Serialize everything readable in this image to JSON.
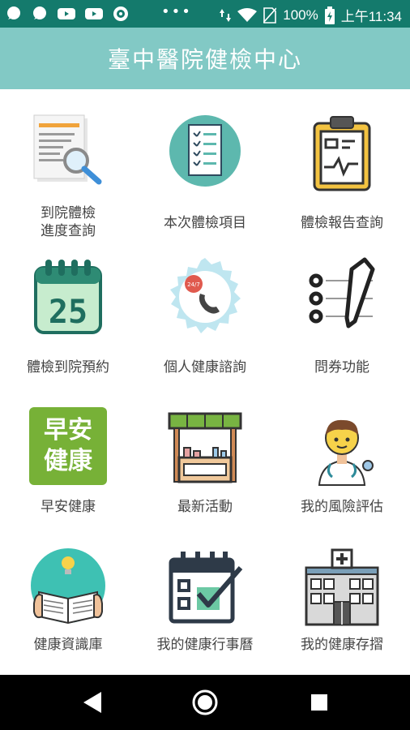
{
  "status": {
    "battery_percent": "100%",
    "time": "上午11:34",
    "icons": [
      "chat-bubble-icon",
      "chat-bubble-icon",
      "youtube-icon",
      "youtube-icon",
      "starbucks-icon",
      "more-dots-icon",
      "data-arrows-icon",
      "wifi-icon",
      "no-sim-icon",
      "battery-icon"
    ]
  },
  "appbar": {
    "title": "臺中醫院健檢中心"
  },
  "tiles": [
    {
      "label": "到院體檢\n進度查詢",
      "icon": "document-search-icon"
    },
    {
      "label": "本次體檢項目",
      "icon": "checklist-icon"
    },
    {
      "label": "體檢報告查詢",
      "icon": "clipboard-report-icon"
    },
    {
      "label": "體檢到院預約",
      "icon": "calendar-25-icon"
    },
    {
      "label": "個人健康諮詢",
      "icon": "phone-24-7-icon"
    },
    {
      "label": "問券功能",
      "icon": "survey-pencil-icon"
    },
    {
      "label": "早安健康",
      "icon": "morning-health-logo",
      "logo_text": [
        "早安",
        "健康"
      ]
    },
    {
      "label": "最新活動",
      "icon": "market-stall-icon"
    },
    {
      "label": "我的風險評估",
      "icon": "doctor-icon"
    },
    {
      "label": "健康資識庫",
      "icon": "reading-book-icon"
    },
    {
      "label": "我的健康行事曆",
      "icon": "calendar-check-icon"
    },
    {
      "label": "我的健康存摺",
      "icon": "hospital-building-icon"
    }
  ],
  "colors": {
    "status_bar": "#147a6c",
    "app_bar": "#82c9c5",
    "teal": "#5db8ae",
    "green_logo": "#77b137"
  }
}
